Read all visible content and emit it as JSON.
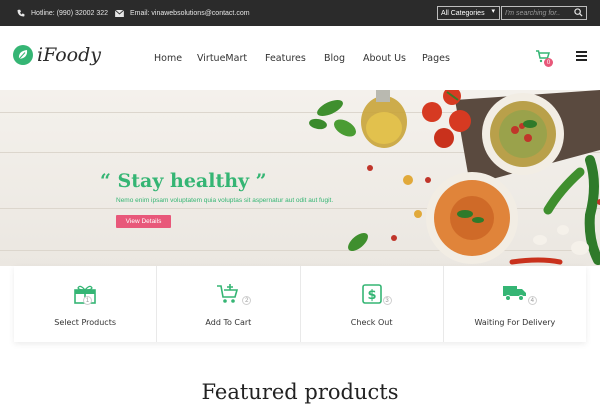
{
  "topbar": {
    "hotline": "Hotline: (990) 32002 322",
    "email": "Email: vinawebsolutions@contact.com",
    "category_select": "All Categories",
    "search_placeholder": "I'm searching for.."
  },
  "header": {
    "logo_text": "iFoody",
    "nav": [
      "Home",
      "VirtueMart",
      "Features",
      "Blog",
      "About Us",
      "Pages"
    ],
    "cart_count": "0"
  },
  "hero": {
    "title": "“ Stay healthy ”",
    "subtitle": "Nemo enim ipsam voluptatem quia voluptas sit aspernatur aut odit aut fugit.",
    "button": "View Details"
  },
  "steps": [
    {
      "icon": "gift-icon",
      "number": "1",
      "label": "Select Products"
    },
    {
      "icon": "cart-add-icon",
      "number": "2",
      "label": "Add To Cart"
    },
    {
      "icon": "dollar-icon",
      "number": "3",
      "label": "Check Out"
    },
    {
      "icon": "truck-icon",
      "number": "4",
      "label": "Waiting For Delivery"
    }
  ],
  "featured_title": "Featured products",
  "colors": {
    "accent_green": "#35b574",
    "accent_pink": "#e8587a",
    "topbar_bg": "#2b2b2b"
  }
}
